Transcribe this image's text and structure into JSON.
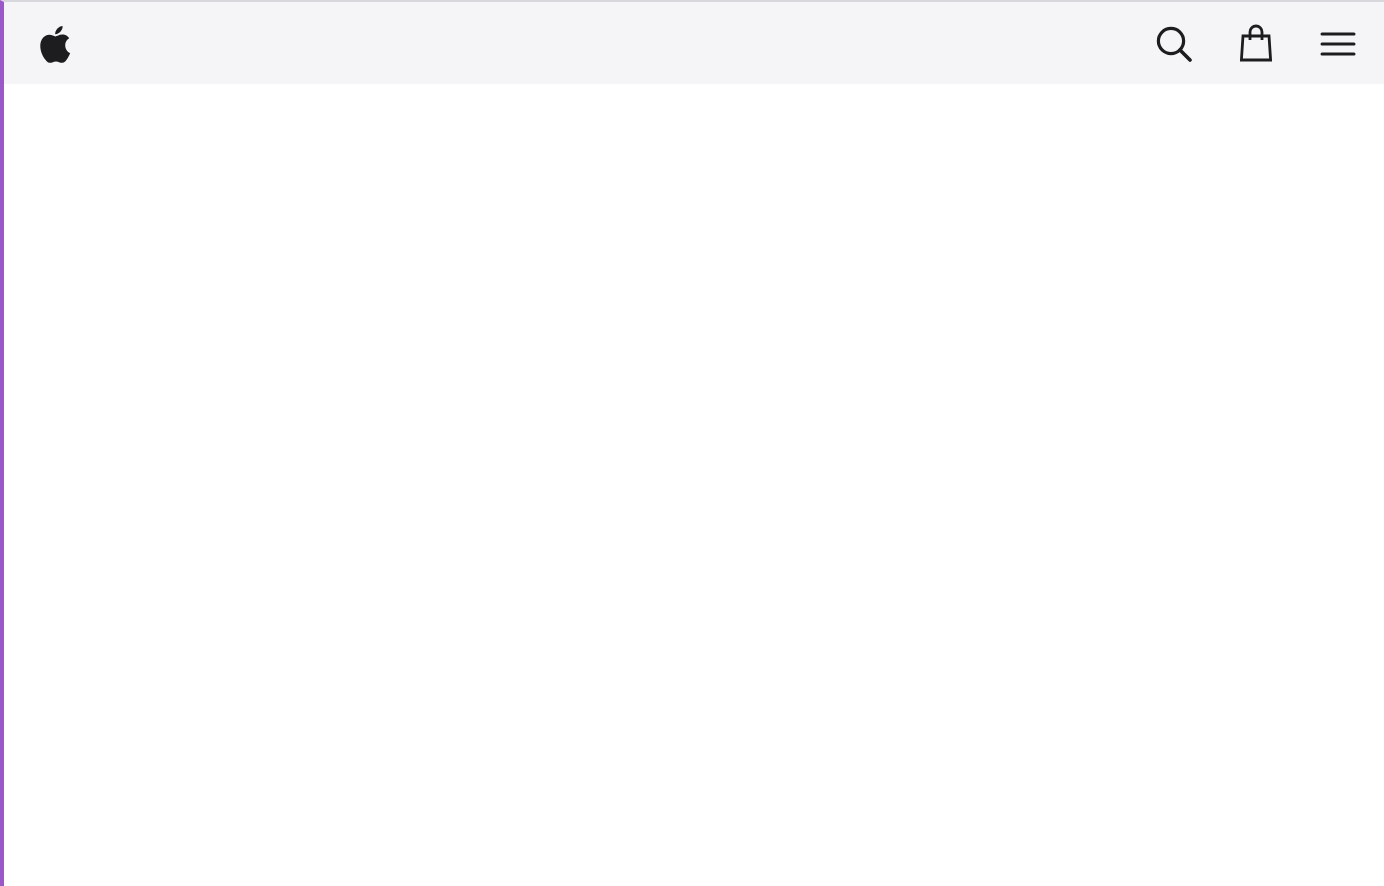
{
  "navbar": {
    "items": [
      {
        "kind": "logo"
      },
      {
        "kind": "search"
      },
      {
        "kind": "bag"
      },
      {
        "kind": "menu"
      }
    ]
  }
}
